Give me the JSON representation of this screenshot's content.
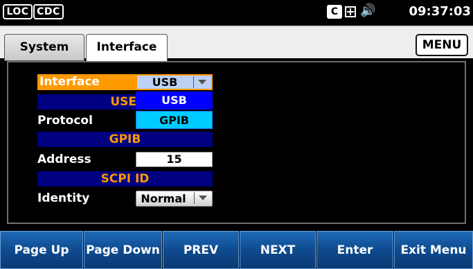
{
  "status_bar": {
    "badges": [
      "LOC",
      "CDC"
    ],
    "remote_icon_text": "C",
    "icons": [
      "remote-ce-icon",
      "panel-lock-icon",
      "speaker-icon"
    ],
    "clock": "09:37:03"
  },
  "tabs": [
    {
      "label": "System",
      "active": false
    },
    {
      "label": "Interface",
      "active": true
    }
  ],
  "menu_button": "MENU",
  "form": {
    "interface_label": "Interface",
    "interface_value": "USB",
    "usb_section": "USE",
    "protocol_label": "Protocol",
    "gpib_section": "GPIB",
    "address_label": "Address",
    "address_value": "15",
    "scpi_section": "SCPI ID",
    "identity_label": "Identity",
    "identity_value": "Normal"
  },
  "dropdown_options": [
    "USB",
    "GPIB"
  ],
  "softkeys": [
    "Page Up",
    "Page Down",
    "PREV",
    "NEXT",
    "Enter",
    "Exit Menu"
  ],
  "colors": {
    "highlight": "#ff9900",
    "section_bar": "#000080",
    "softkey": "#0f4b8f",
    "selected_option": "#0000ff",
    "hover_option": "#00ccff"
  }
}
